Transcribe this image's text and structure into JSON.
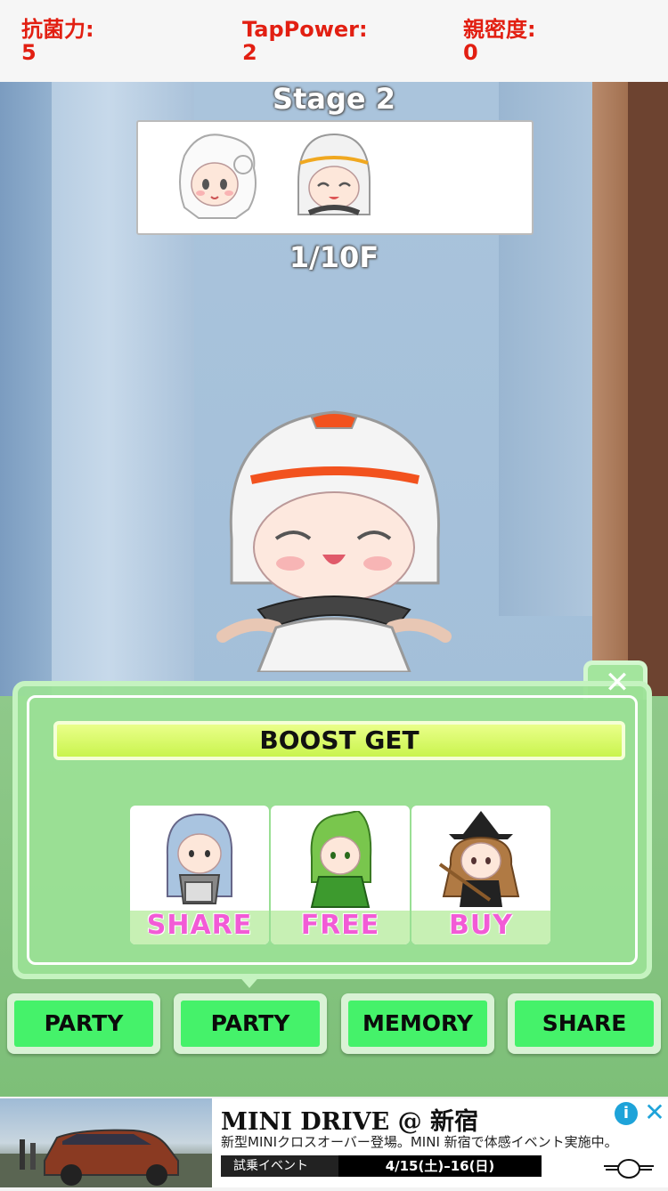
{
  "stats": [
    {
      "label": "抗菌力:",
      "value": "5"
    },
    {
      "label": "TapPower:",
      "value": "2"
    },
    {
      "label": "親密度:",
      "value": "0"
    }
  ],
  "stage": {
    "title": "Stage 2",
    "floor": "1/10F"
  },
  "party": {
    "members": [
      "white-haired-girl-avatar-icon",
      "dome-helmet-girl-avatar-icon"
    ]
  },
  "popup": {
    "title": "BOOST GET",
    "close_icon": "close-icon",
    "options": [
      {
        "label": "SHARE",
        "icon": "hooded-blue-girl-icon"
      },
      {
        "label": "FREE",
        "icon": "green-leaf-girl-icon"
      },
      {
        "label": "BUY",
        "icon": "witch-broom-girl-icon"
      }
    ]
  },
  "buttons": [
    {
      "label": "PARTY"
    },
    {
      "label": "PARTY"
    },
    {
      "label": "MEMORY"
    },
    {
      "label": "SHARE"
    }
  ],
  "ad": {
    "title": "MINI DRIVE @ 新宿",
    "description": "新型MINIクロスオーバー登場。MINI 新宿で体感イベント実施中。",
    "tag": "試乗イベント",
    "date": "4/15(土)–16(日)",
    "info_icon": "info-icon",
    "close_icon": "close-icon"
  },
  "colors": {
    "stat_text": "#e21f12",
    "button_green": "#45f26a",
    "boost_bar": "#d6f865",
    "option_label": "#f25bd6"
  }
}
